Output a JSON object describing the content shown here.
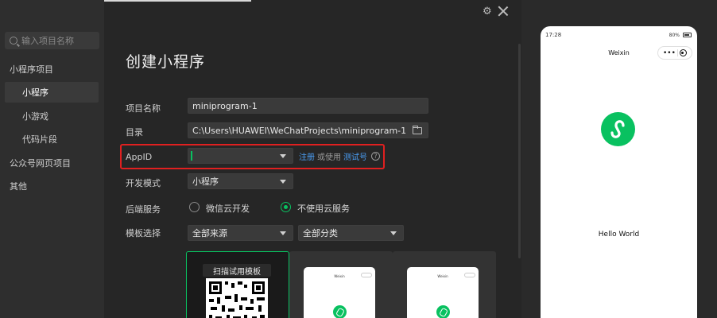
{
  "sidebar": {
    "search_placeholder": "输入项目名称",
    "items": [
      {
        "label": "小程序项目"
      },
      {
        "label": "小程序"
      },
      {
        "label": "小游戏"
      },
      {
        "label": "代码片段"
      },
      {
        "label": "公众号网页项目"
      },
      {
        "label": "其他"
      }
    ]
  },
  "header": {
    "settings_icon": "gear-icon",
    "close_icon": "close-icon"
  },
  "form": {
    "title": "创建小程序",
    "project_name_label": "项目名称",
    "project_name_value": "miniprogram-1",
    "directory_label": "目录",
    "directory_value": "C:\\Users\\HUAWEI\\WeChatProjects\\miniprogram-1",
    "appid_label": "AppID",
    "appid_value": "",
    "register_link": "注册",
    "or_use_text": "或使用",
    "test_account_link": "测试号",
    "dev_mode_label": "开发模式",
    "dev_mode_value": "小程序",
    "backend_label": "后端服务",
    "backend_options": [
      {
        "label": "微信云开发",
        "checked": false
      },
      {
        "label": "不使用云服务",
        "checked": true
      }
    ],
    "template_label": "模板选择",
    "template_source_value": "全部来源",
    "template_category_value": "全部分类",
    "scan_template_label": "扫描试用模板"
  },
  "preview": {
    "time": "17:28",
    "battery": "80%",
    "nav_title": "Weixin",
    "content": "Hello World"
  },
  "colors": {
    "accent_green": "#09c160",
    "link_blue": "#4b9ef5",
    "highlight_red": "#e02020"
  }
}
